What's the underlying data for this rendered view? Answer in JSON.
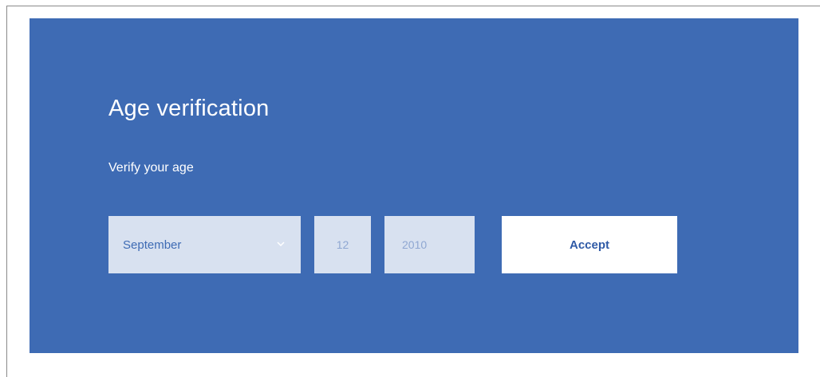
{
  "age_gate": {
    "title": "Age verification",
    "subtitle": "Verify your age",
    "month": {
      "value": "September",
      "icon": "chevron-down-icon"
    },
    "day": {
      "value": "12"
    },
    "year": {
      "value": "2010"
    },
    "accept_label": "Accept"
  },
  "colors": {
    "panel_background": "#3e6bb4",
    "field_background": "#d8e1f0",
    "button_background": "#ffffff",
    "button_text": "#2f5aa6"
  }
}
